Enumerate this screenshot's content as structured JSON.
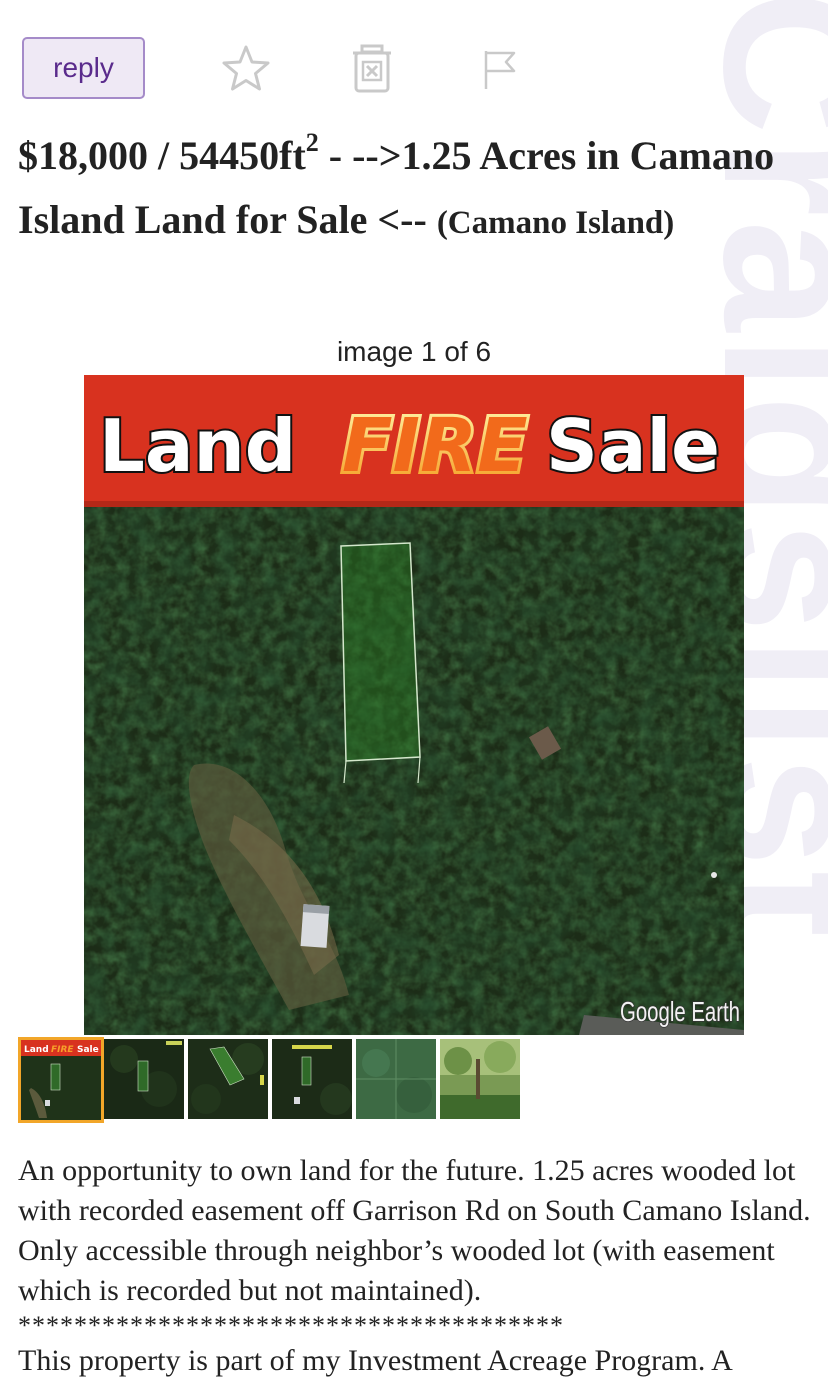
{
  "actions": {
    "reply_label": "reply",
    "favorite_icon": "star-icon",
    "hide_icon": "trash-x-icon",
    "flag_icon": "flag-icon"
  },
  "watermark": "Craigslist",
  "posting": {
    "price": "$18,000",
    "separator": " / ",
    "area": "54450ft",
    "area_sup": "2",
    "title": " - -->1.25 Acres in Camano Island Land for Sale <-- ",
    "location": "(Camano Island)"
  },
  "gallery": {
    "caption": "image 1 of 6",
    "banner_words": [
      "Land",
      "FIRE",
      "Sale"
    ],
    "credit": "Google Earth",
    "thumbnails": [
      {
        "type": "banner",
        "selected": true
      },
      {
        "type": "aerial",
        "selected": false
      },
      {
        "type": "aerial",
        "selected": false
      },
      {
        "type": "aerial",
        "selected": false
      },
      {
        "type": "aerial-flat",
        "selected": false
      },
      {
        "type": "forest",
        "selected": false
      }
    ],
    "colors": {
      "banner_red": "#d8321f",
      "forest_dark": "#1c2c17",
      "parcel": "#1f5a1a",
      "selected_border": "#f2a629"
    }
  },
  "description": {
    "paragraph1": "An opportunity to own land for the future. 1.25 acres wooded lot with recorded easement off Garrison Rd on South Camano Island. Only accessible through neighbor’s wooded lot (with easement which is recorded but not maintained).",
    "separator": "***************************************",
    "paragraph2": "This property is part of my Investment Acreage Program. A"
  }
}
